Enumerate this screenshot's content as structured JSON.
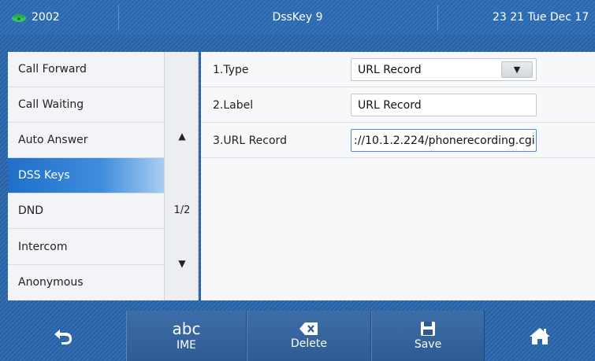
{
  "status_bar": {
    "line_number": "2002",
    "title": "DssKey 9",
    "clock": "23 21 Tue Dec 17",
    "icons": {
      "line": "phone-handset-icon"
    }
  },
  "menu": {
    "items": [
      {
        "label": "Call Forward"
      },
      {
        "label": "Call Waiting"
      },
      {
        "label": "Auto Answer"
      },
      {
        "label": "DSS Keys",
        "active": true
      },
      {
        "label": "DND"
      },
      {
        "label": "Intercom"
      },
      {
        "label": "Anonymous"
      }
    ]
  },
  "pager": {
    "up": "▲",
    "page": "1/2",
    "down": "▼"
  },
  "settings": {
    "type": {
      "label": "1.Type",
      "value": "URL Record",
      "dropdown_glyph": "▼"
    },
    "label": {
      "label": "2.Label",
      "value": "URL Record"
    },
    "url": {
      "label": "3.URL Record",
      "value": "://10.1.2.224/phonerecording.cgi"
    }
  },
  "softkeys": {
    "back": {
      "icon": "back-arrow-icon"
    },
    "ime": {
      "top": "abc",
      "label": "IME"
    },
    "delete": {
      "label": "Delete",
      "icon": "backspace-icon"
    },
    "save": {
      "label": "Save",
      "icon": "floppy-disk-icon"
    },
    "home": {
      "icon": "home-icon"
    }
  },
  "colors": {
    "accent": "#1f6fc8",
    "background": "#2c66aa"
  }
}
